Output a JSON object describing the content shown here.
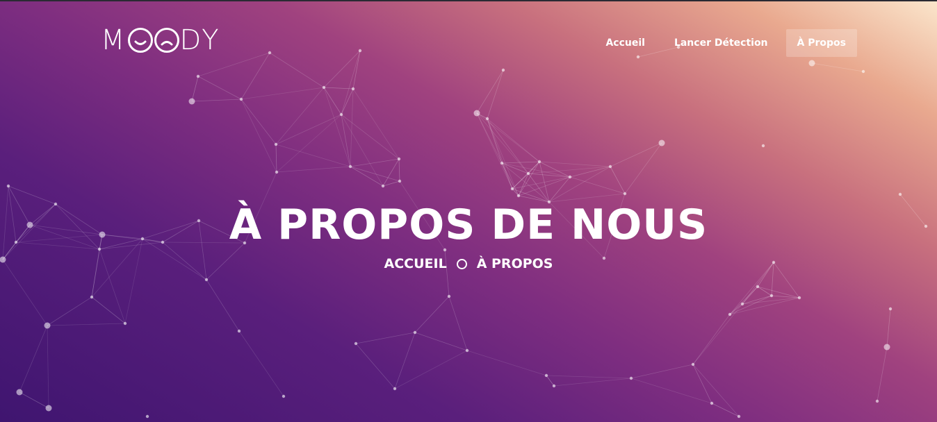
{
  "brand": {
    "logo_text": "MOODY"
  },
  "nav": {
    "items": [
      {
        "label": "Accueil",
        "active": false
      },
      {
        "label": "Lancer Détection",
        "active": false
      },
      {
        "label": "À Propos",
        "active": true
      }
    ]
  },
  "hero": {
    "title": "À PROPOS DE NOUS",
    "breadcrumb": {
      "home": "ACCUEIL",
      "current": "À PROPOS"
    }
  },
  "colors": {
    "text": "#ffffff",
    "gradient_light": "#fbe6cc",
    "gradient_mid": "#a0427f",
    "gradient_dark": "#3f1570"
  }
}
